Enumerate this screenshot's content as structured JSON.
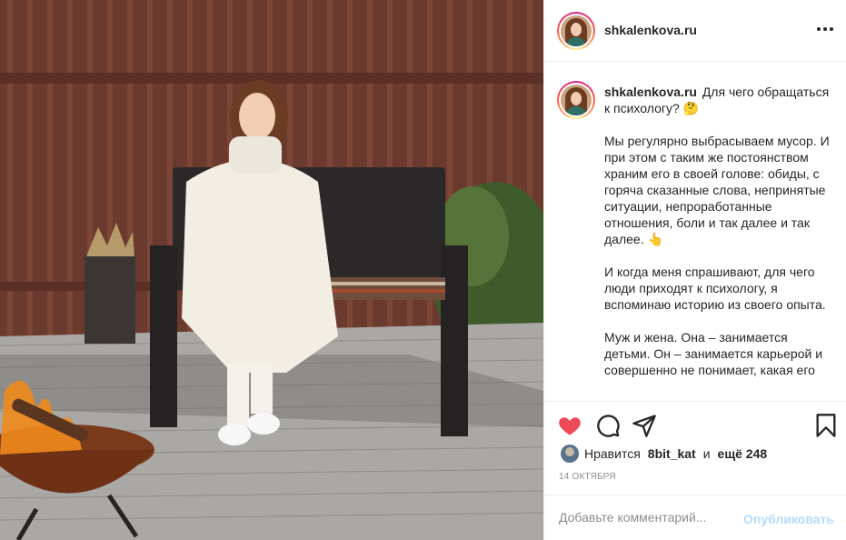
{
  "header": {
    "username": "shkalenkova.ru",
    "more_icon": "more-horizontal-icon"
  },
  "caption": {
    "username": "shkalenkova.ru",
    "paragraphs": [
      "Для чего обращаться к психологу? 🤔",
      "Мы регулярно выбрасываем мусор. И при этом с таким же постоянством храним его в своей голове: обиды, с горяча сказанные слова, непринятые ситуации, непроработанные отношения, боли и так далее и так далее. 👆",
      "И когда меня спрашивают, для чего люди приходят к психологу, я вспоминаю историю из своего опыта.",
      "Муж и жена. Она – занимается детьми. Он – занимается карьерой и совершенно не понимает, какая его"
    ]
  },
  "actions": {
    "like_icon": "heart-filled-icon",
    "comment_icon": "comment-icon",
    "share_icon": "share-icon",
    "save_icon": "bookmark-icon",
    "like_color": "#ed4956"
  },
  "likes": {
    "prefix": "Нравится",
    "user": "8bit_kat",
    "conj": "и",
    "others": "ещё 248"
  },
  "date": "14 ОКТЯБРЯ",
  "comment": {
    "placeholder": "Добавьте комментарий...",
    "publish_label": "Опубликовать",
    "publish_color": "#b3dbff"
  }
}
